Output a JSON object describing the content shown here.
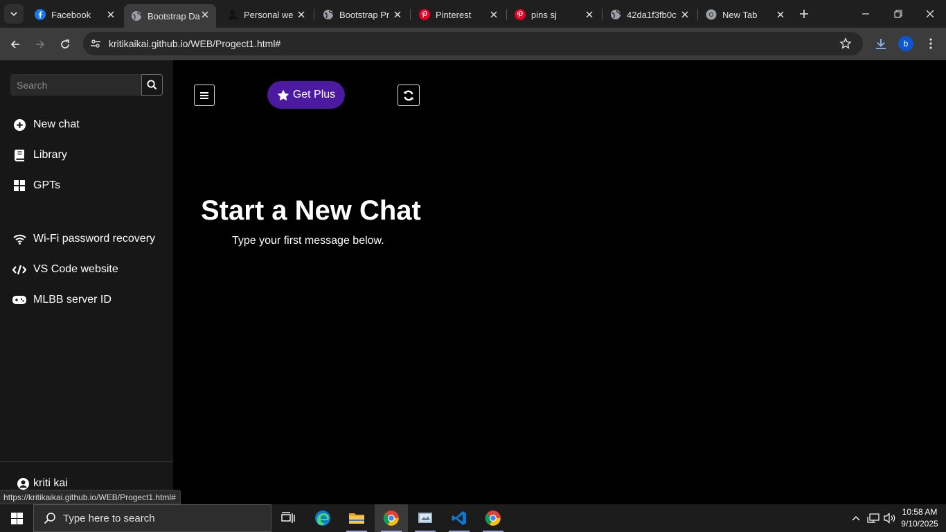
{
  "browser": {
    "tabs": [
      {
        "title": "Facebook",
        "icon": "facebook-icon",
        "active": false
      },
      {
        "title": "Bootstrap Da",
        "icon": "globe-icon",
        "active": true
      },
      {
        "title": "Personal we",
        "icon": "person-icon",
        "active": false
      },
      {
        "title": "Bootstrap Pr",
        "icon": "globe-icon",
        "active": false
      },
      {
        "title": "Pinterest",
        "icon": "pinterest-icon",
        "active": false
      },
      {
        "title": "pins sj",
        "icon": "pinterest-icon",
        "active": false
      },
      {
        "title": "42da1f3fb0c",
        "icon": "globe-icon",
        "active": false
      },
      {
        "title": "New Tab",
        "icon": "chrome-icon",
        "active": false
      }
    ],
    "url": "kritikaikai.github.io/WEB/Progect1.html#",
    "profile_initial": "b",
    "status_url": "https://kritikaikai.github.io/WEB/Progect1.html#"
  },
  "sidebar": {
    "search_placeholder": "Search",
    "primary": [
      {
        "label": "New chat",
        "icon": "plus-circle-icon"
      },
      {
        "label": "Library",
        "icon": "book-icon"
      },
      {
        "label": "GPTs",
        "icon": "grid-icon"
      }
    ],
    "history": [
      {
        "label": "Wi-Fi password recovery",
        "icon": "wifi-icon"
      },
      {
        "label": "VS Code website",
        "icon": "code-icon"
      },
      {
        "label": "MLBB server ID",
        "icon": "gamepad-icon"
      }
    ],
    "user": {
      "name": "kriti kai",
      "icon": "user-circle-icon"
    }
  },
  "main": {
    "plus_label": "Get Plus",
    "title": "Start a New Chat",
    "subtitle": "Type your first message below."
  },
  "taskbar": {
    "search_placeholder": "Type here to search",
    "time": "10:58 AM",
    "date": "9/10/2025"
  },
  "colors": {
    "plus_button": "#4b1aa0",
    "sidebar_bg": "#171717",
    "page_bg": "#000000"
  }
}
